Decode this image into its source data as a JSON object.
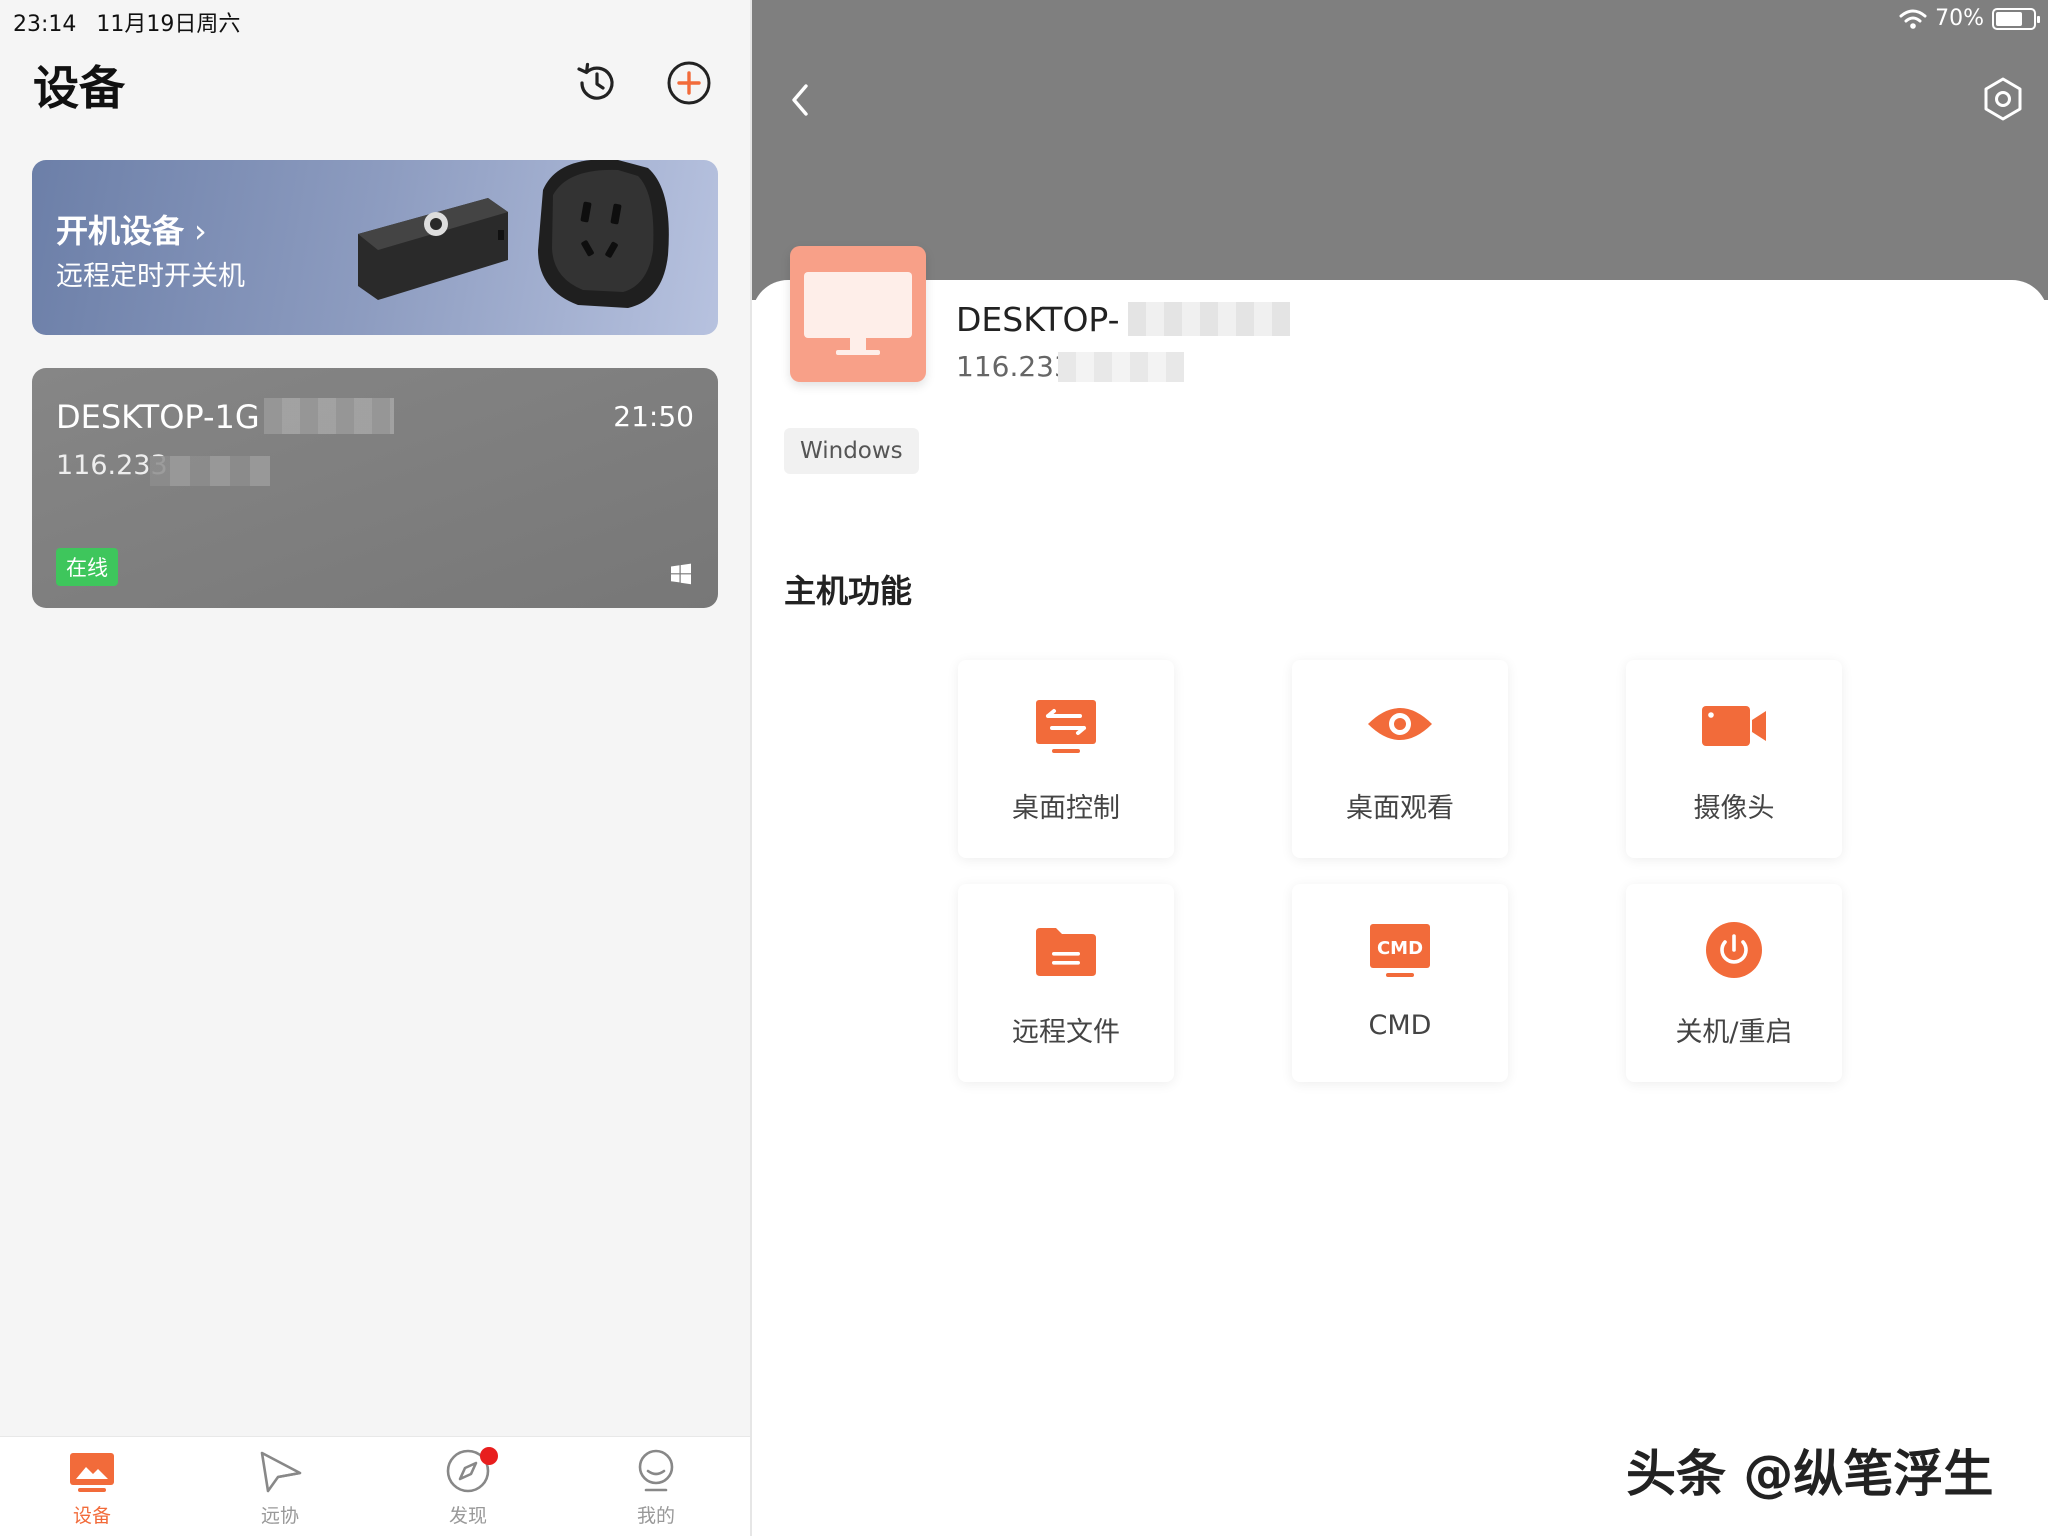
{
  "status_bar": {
    "time": "23:14",
    "date": "11月19日周六",
    "battery": "70%"
  },
  "left": {
    "title": "设备",
    "banner": {
      "title": "开机设备",
      "subtitle": "远程定时开关机"
    },
    "device": {
      "name": "DESKTOP-1G",
      "ip": "116.233",
      "time": "21:50",
      "status": "在线"
    }
  },
  "tabbar": {
    "items": [
      {
        "label": "设备",
        "icon": "device-icon",
        "active": true
      },
      {
        "label": "远协",
        "icon": "send-icon"
      },
      {
        "label": "发现",
        "icon": "compass-icon"
      },
      {
        "label": "我的",
        "icon": "profile-icon"
      }
    ]
  },
  "right": {
    "host": {
      "name": "DESKTOP-",
      "ip": "116.233",
      "os": "Windows"
    },
    "section_title": "主机功能",
    "functions": [
      {
        "label": "桌面控制",
        "icon": "desktop-control-icon"
      },
      {
        "label": "桌面观看",
        "icon": "eye-icon"
      },
      {
        "label": "摄像头",
        "icon": "camera-icon"
      },
      {
        "label": "远程文件",
        "icon": "folder-icon"
      },
      {
        "label": "CMD",
        "icon": "cmd-icon",
        "badge": "CMD"
      },
      {
        "label": "关机/重启",
        "icon": "power-icon"
      }
    ]
  },
  "watermark": "头条 @纵笔浮生",
  "colors": {
    "accent": "#f26b3a",
    "online": "#3ec65c",
    "header_gray": "#7f7f7f",
    "banner": "#8d9cc0"
  }
}
